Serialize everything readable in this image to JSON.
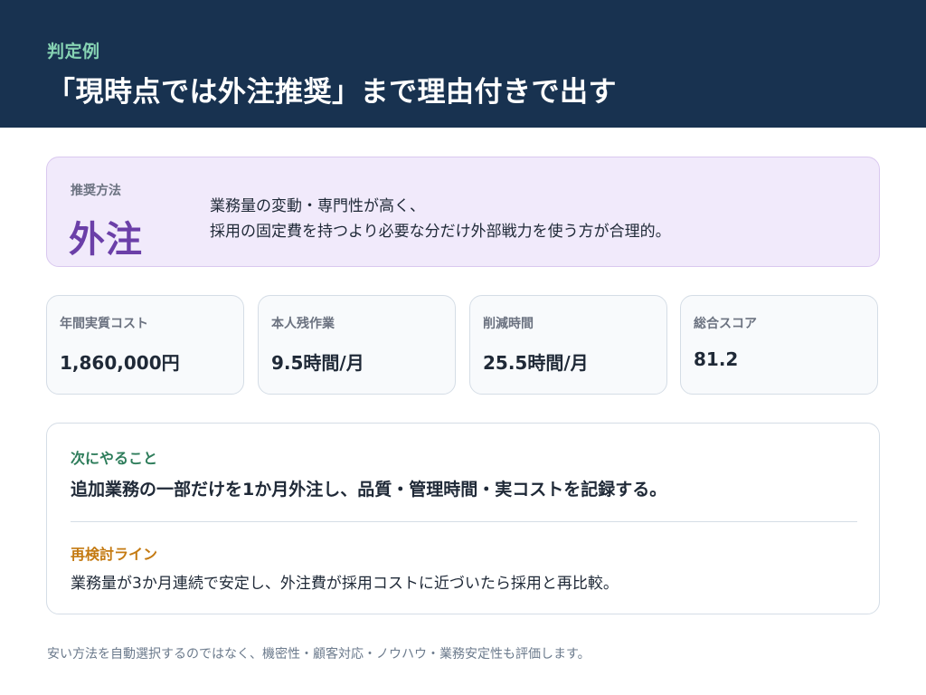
{
  "header": {
    "eyebrow": "判定例",
    "title": "「現時点では外注推奨」まで理由付きで出す"
  },
  "recommendation": {
    "label": "推奨方法",
    "value": "外注",
    "reason_lines": [
      "業務量の変動・専門性が高く、",
      "採用の固定費を持つより必要な分だけ外部戦力を使う方が合理的。"
    ]
  },
  "metrics": [
    {
      "label": "年間実質コスト",
      "value": "1,860,000円"
    },
    {
      "label": "本人残作業",
      "value": "9.5時間/月"
    },
    {
      "label": "削減時間",
      "value": "25.5時間/月"
    },
    {
      "label": "総合スコア",
      "value": "81.2"
    }
  ],
  "next_action": {
    "label": "次にやること",
    "text": "追加業務の一部だけを1か月外注し、品質・管理時間・実コストを記録する。"
  },
  "review_line": {
    "label": "再検討ライン",
    "text": "業務量が3か月連続で安定し、外注費が採用コストに近づいたら採用と再比較。"
  },
  "footnote": "安い方法を自動選択するのではなく、機密性・顧客対応・ノウハウ・業務安定性も評価します。",
  "colors": {
    "header_bg": "#183250",
    "eyebrow": "#86d3b3",
    "recommend_accent": "#6b3fa8",
    "recommend_bg": "#f1eafb",
    "next_label": "#2e7d5b",
    "review_label": "#c47a12"
  }
}
